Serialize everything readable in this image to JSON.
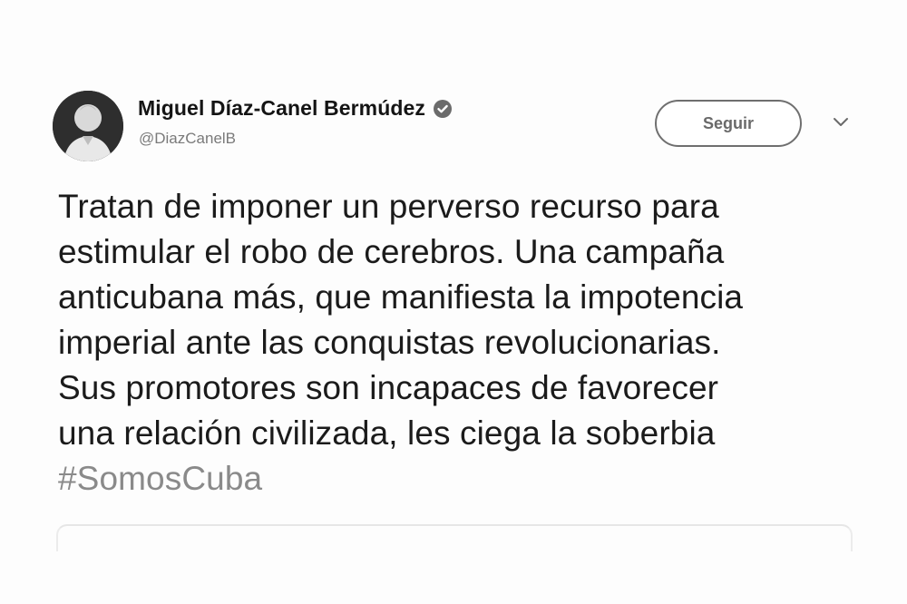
{
  "tweet": {
    "author": {
      "display_name": "Miguel Díaz-Canel Bermúdez",
      "handle": "@DiazCanelB",
      "verified_icon": "verified-badge-icon",
      "avatar": "profile-photo"
    },
    "follow_button_label": "Seguir",
    "menu_icon": "chevron-down-icon",
    "text_lines": [
      "Tratan de imponer un perverso recurso para",
      "estimular el robo de cerebros. Una campaña",
      "anticubana más, que manifiesta la impotencia",
      "imperial ante las conquistas revolucionarias.",
      "Sus promotores son incapaces de favorecer",
      "una relación civilizada, les ciega la soberbia"
    ],
    "hashtag": "#SomosCuba"
  },
  "colors": {
    "text": "#1b1b1b",
    "muted": "#7a7a7a",
    "hashtag": "#8a8a8a",
    "button_border": "#6f6f6f"
  }
}
